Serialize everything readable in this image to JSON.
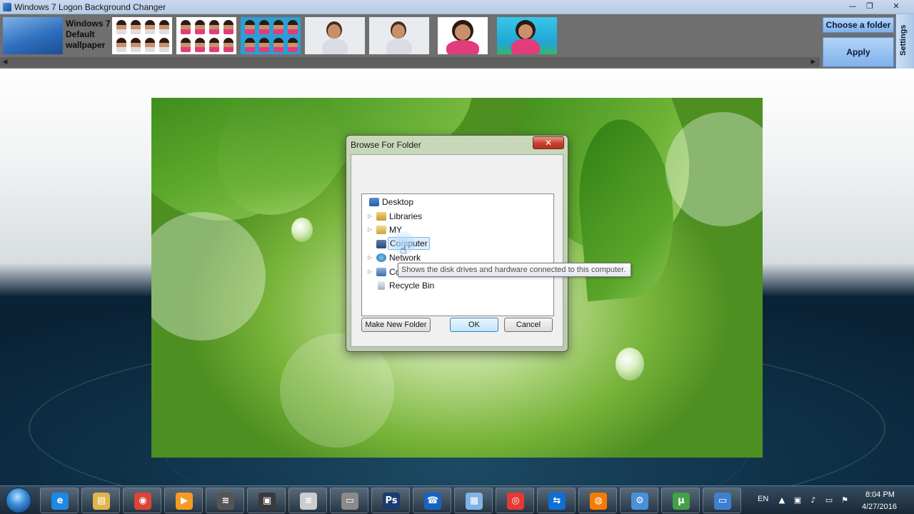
{
  "window": {
    "title": "Windows 7 Logon Background Changer",
    "minimize": "—",
    "maximize": "❐",
    "close": "✕"
  },
  "toolbar": {
    "default_wallpaper_label": "Windows 7 Default wallpaper",
    "choose_folder": "Choose a folder",
    "apply": "Apply",
    "settings": "Settings",
    "scroll_left": "◀",
    "scroll_right": "▶"
  },
  "dialog": {
    "title": "Browse For Folder",
    "close": "✕",
    "tree": [
      {
        "label": "Desktop",
        "expander": ""
      },
      {
        "label": "Libraries",
        "expander": "▷"
      },
      {
        "label": "MY",
        "expander": "▷"
      },
      {
        "label": "Computer",
        "expander": ""
      },
      {
        "label": "Network",
        "expander": "▷"
      },
      {
        "label": "Co",
        "expander": "▷"
      },
      {
        "label": "Recycle Bin",
        "expander": ""
      }
    ],
    "make_new_folder": "Make New Folder",
    "ok": "OK",
    "cancel": "Cancel",
    "tooltip": "Shows the disk drives and hardware connected to this computer."
  },
  "taskbar": {
    "language": "EN",
    "time": "8:04 PM",
    "date": "4/27/2016",
    "apps": [
      {
        "name": "internet-explorer",
        "glyph": "e",
        "color": "#1e88e5"
      },
      {
        "name": "file-explorer",
        "glyph": "▤",
        "color": "#e0b44c"
      },
      {
        "name": "chrome",
        "glyph": "◉",
        "color": "#db4437"
      },
      {
        "name": "media-player",
        "glyph": "▶",
        "color": "#f59b23"
      },
      {
        "name": "audio-editor",
        "glyph": "≋",
        "color": "#555555"
      },
      {
        "name": "video-editor",
        "glyph": "▣",
        "color": "#3a3a3a"
      },
      {
        "name": "text-editor",
        "glyph": "≡",
        "color": "#cccccc"
      },
      {
        "name": "remote-desktop",
        "glyph": "▭",
        "color": "#8a8a8a"
      },
      {
        "name": "photoshop",
        "glyph": "Ps",
        "color": "#1b3b6f"
      },
      {
        "name": "phone-app",
        "glyph": "☎",
        "color": "#1565c0"
      },
      {
        "name": "striped-app",
        "glyph": "▦",
        "color": "#7fb3e6"
      },
      {
        "name": "swirl-app",
        "glyph": "◎",
        "color": "#e53935"
      },
      {
        "name": "teamviewer",
        "glyph": "⇆",
        "color": "#0e6fd6"
      },
      {
        "name": "firefox",
        "glyph": "◍",
        "color": "#f57c00"
      },
      {
        "name": "network-app",
        "glyph": "⚙",
        "color": "#4a90d9"
      },
      {
        "name": "utorrent",
        "glyph": "µ",
        "color": "#43a047"
      },
      {
        "name": "logon-changer",
        "glyph": "▭",
        "color": "#3f7fd0"
      }
    ]
  }
}
